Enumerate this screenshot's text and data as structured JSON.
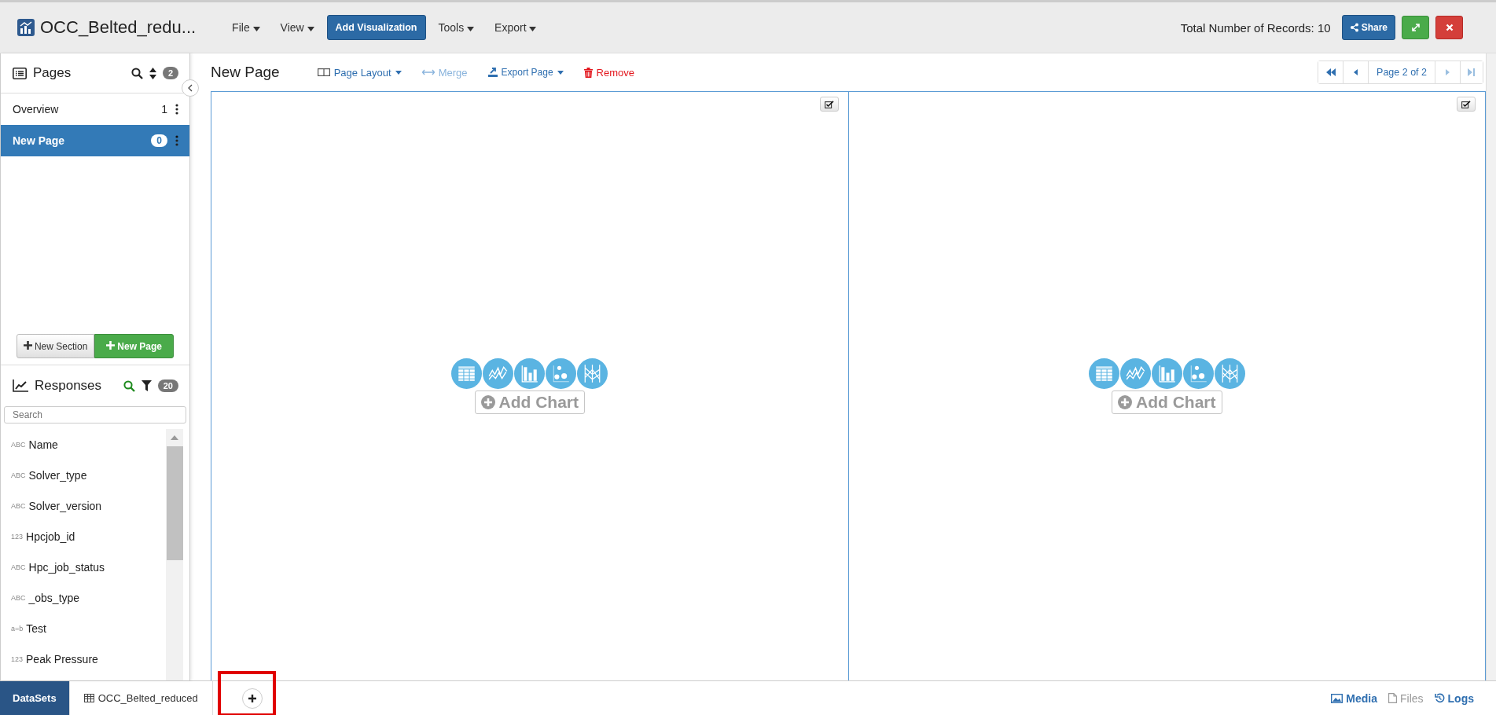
{
  "app": {
    "title": "OCC_Belted_redu...",
    "menus": [
      {
        "label": "File",
        "kind": "menu"
      },
      {
        "label": "View",
        "kind": "menu"
      },
      {
        "label": "Add Visualization",
        "kind": "button"
      },
      {
        "label": "Tools",
        "kind": "menu"
      },
      {
        "label": "Export",
        "kind": "menu"
      }
    ],
    "records": "Total Number of Records: 10",
    "share": "Share"
  },
  "pages_panel": {
    "title": "Pages",
    "count": "2",
    "items": [
      {
        "label": "Overview",
        "count": "1",
        "selected": false
      },
      {
        "label": "New Page",
        "count": "0",
        "selected": true
      }
    ],
    "buttons": [
      {
        "label": "New Section",
        "kind": "default"
      },
      {
        "label": "New Page",
        "kind": "primary"
      }
    ]
  },
  "responses_panel": {
    "title": "Responses",
    "count": "20",
    "search": {
      "placeholder": "Search"
    },
    "fields": [
      {
        "type": "ABC",
        "name": "Name"
      },
      {
        "type": "ABC",
        "name": "Solver_type"
      },
      {
        "type": "ABC",
        "name": "Solver_version"
      },
      {
        "type": "123",
        "name": "Hpcjob_id"
      },
      {
        "type": "ABC",
        "name": "Hpc_job_status"
      },
      {
        "type": "ABC",
        "name": "_obs_type"
      },
      {
        "type": "a=b",
        "name": "Test"
      },
      {
        "type": "123",
        "name": "Peak Pressure"
      }
    ]
  },
  "page": {
    "title": "New Page",
    "actions": [
      {
        "label": "Page Layout",
        "kind": "layout",
        "disabled": false
      },
      {
        "label": "Merge",
        "kind": "merge",
        "disabled": true
      },
      {
        "label": "Export Page",
        "kind": "export",
        "disabled": false
      },
      {
        "label": "Remove",
        "kind": "remove",
        "disabled": false
      }
    ],
    "pager": "Page 2 of 2",
    "slots": [
      {
        "action": "Add Chart"
      },
      {
        "action": "Add Chart"
      }
    ]
  },
  "bottom": {
    "tabs": [
      {
        "label": "DataSets",
        "selected": true
      },
      {
        "label": "OCC_Belted_reduced",
        "selected": false
      }
    ],
    "links": [
      {
        "label": "Media",
        "kind": "media",
        "disabled": false
      },
      {
        "label": "Files",
        "kind": "files",
        "disabled": true
      },
      {
        "label": "Logs",
        "kind": "logs",
        "disabled": false
      }
    ]
  }
}
